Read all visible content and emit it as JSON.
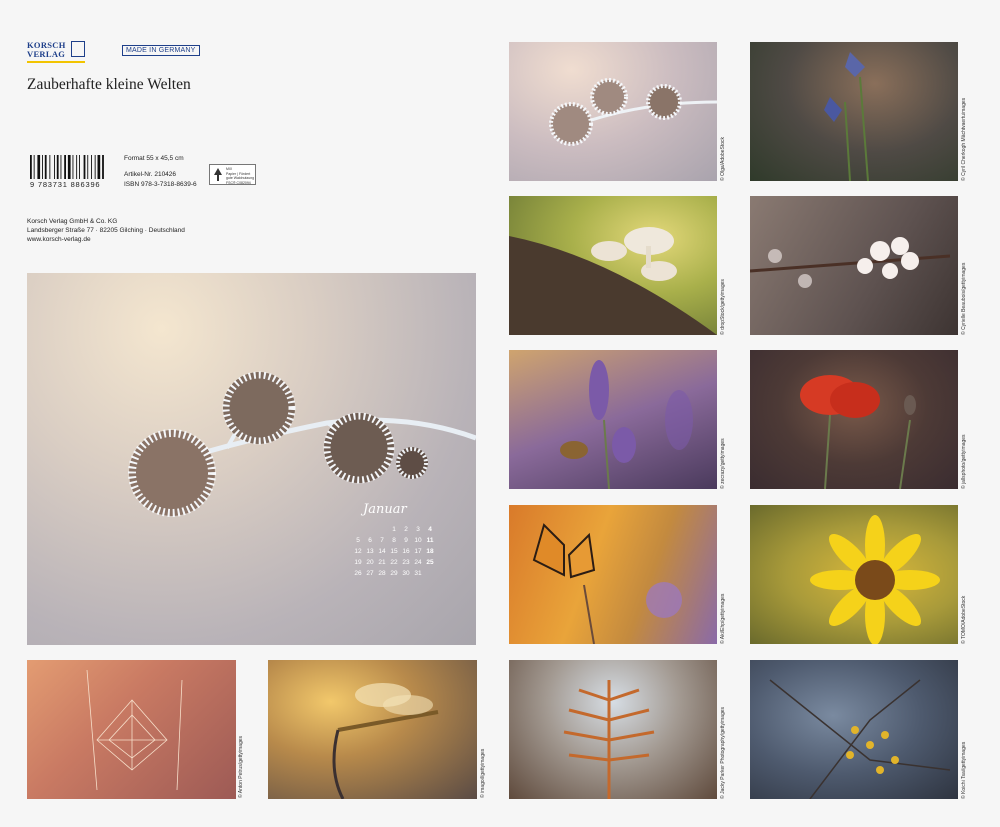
{
  "publisher": {
    "logo_line1": "KORSCH",
    "logo_line2": "VERLAG",
    "made_in": "MADE IN GERMANY",
    "address_line1": "Korsch Verlag GmbH & Co. KG",
    "address_line2": "Landsberger Straße 77 · 82205 Gilching · Deutschland",
    "website": "www.korsch-verlag.de"
  },
  "calendar_title": "Zauberhafte kleine Welten",
  "product": {
    "barcode_number": "9 783731 886396",
    "format": "Format 55 x 45,5 cm",
    "article": "Artikel-Nr. 210426",
    "isbn": "ISBN 978-3-7318-8639-6",
    "fsc_label": "MIX\nPapier | Fördert\ngute Waldnutzung\nFSC® C082094"
  },
  "cover": {
    "month": "Januar",
    "days": [
      "",
      "",
      "",
      "1",
      "2",
      "3",
      "4",
      "5",
      "6",
      "7",
      "8",
      "9",
      "10",
      "11",
      "12",
      "13",
      "14",
      "15",
      "16",
      "17",
      "18",
      "19",
      "20",
      "21",
      "22",
      "23",
      "24",
      "25",
      "26",
      "27",
      "28",
      "29",
      "30",
      "31",
      ""
    ]
  },
  "photos": [
    {
      "id": "cover",
      "subject": "frosted thistle",
      "credit": ""
    },
    {
      "id": "spiderweb",
      "subject": "spider web",
      "credit": "© Anton Petrus/gettyimages"
    },
    {
      "id": "dragonfly",
      "subject": "dragonfly",
      "credit": "© imagoil/gettyimages"
    },
    {
      "id": "frost-small",
      "subject": "frosted thistle",
      "credit": "© Olga/AdobeStock"
    },
    {
      "id": "mushroom",
      "subject": "mushrooms",
      "credit": "© dropStock/gettyimages"
    },
    {
      "id": "lavender",
      "subject": "lavender with bee",
      "credit": "© zecrazy/gettyimages"
    },
    {
      "id": "butterfly",
      "subject": "butterfly",
      "credit": "© Aki/Ehp/gettyimages"
    },
    {
      "id": "fern",
      "subject": "autumn fern",
      "credit": "© Jacky Parker Photography/gettyimages"
    },
    {
      "id": "bluebell",
      "subject": "bluebell",
      "credit": "© Cyril Cherkogh Mächtvaertuimages"
    },
    {
      "id": "blossom",
      "subject": "cherry blossom",
      "credit": "© Cyrielle Beaubois/gettyimages"
    },
    {
      "id": "poppy",
      "subject": "red poppy",
      "credit": "© jallsphoto/gettyimages"
    },
    {
      "id": "sunflower",
      "subject": "sunflower",
      "credit": "© TOMO/AdobeStock"
    },
    {
      "id": "buds",
      "subject": "yellow buds",
      "credit": "© Koichi Tsai/gettyimages"
    }
  ],
  "colors": {
    "brand_blue": "#1e3f8a",
    "brand_yellow": "#f2c400",
    "background": "#f6f6f6"
  }
}
